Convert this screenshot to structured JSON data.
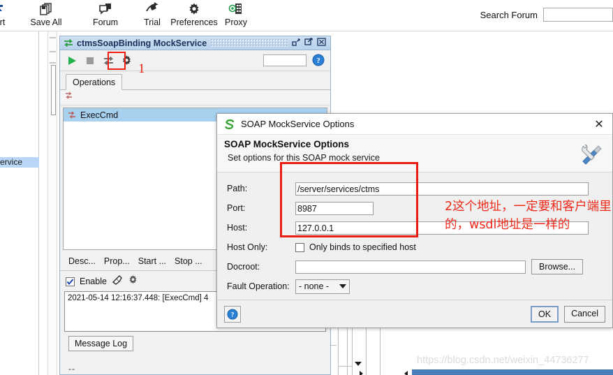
{
  "toolbar": {
    "items": [
      {
        "label": "ort",
        "icon": "import-icon"
      },
      {
        "label": "Save All",
        "icon": "save-all-icon"
      },
      {
        "label": "Forum",
        "icon": "forum-icon"
      },
      {
        "label": "Trial",
        "icon": "trial-icon"
      },
      {
        "label": "Preferences",
        "icon": "gear-icon"
      },
      {
        "label": "Proxy",
        "icon": "proxy-icon"
      }
    ],
    "search_forum_label": "Search Forum",
    "search_forum_value": "",
    "search_forum_placeholder": ""
  },
  "navigator": {
    "selected_item": "ckService"
  },
  "mock_window": {
    "title": "ctmsSoapBinding MockService",
    "title_icon": "mockservice-icon",
    "controls": {
      "minimize": "minimize-icon",
      "maximize": "maximize-icon",
      "close": "close-icon"
    },
    "toolbar": {
      "run": "run-icon",
      "stop": "stop-icon",
      "dispatch": "dispatch-icon",
      "options": "gear-icon",
      "field_value": "",
      "help": "help-icon"
    },
    "callout_1": "1",
    "tabs": [
      {
        "label": "Operations",
        "active": true
      }
    ],
    "operations": [
      {
        "label": "ExecCmd",
        "selected": true
      }
    ],
    "buttons": [
      "Desc...",
      "Prop...",
      "Start ...",
      "Stop ..."
    ],
    "enable_checkbox": {
      "label": "Enable",
      "checked": true
    },
    "log_line": "2021-05-14 12:16:37.448: [ExecCmd] 4",
    "message_log_tab": "Message Log",
    "status_dashes": "--"
  },
  "dialog": {
    "window_title": "SOAP MockService Options",
    "window_icon": "soapui-icon",
    "close_label": "✕",
    "banner_title": "SOAP MockService Options",
    "banner_subtitle": "Set options for this SOAP mock service",
    "banner_icon": "tools-icon",
    "fields": {
      "path": {
        "label": "Path:",
        "value": "/server/services/ctms"
      },
      "port": {
        "label": "Port:",
        "value": "8987"
      },
      "host": {
        "label": "Host:",
        "value": "127.0.0.1"
      },
      "host_only": {
        "label": "Host Only:",
        "checkbox_label": "Only binds to specified host",
        "checked": false
      },
      "docroot": {
        "label": "Docroot:",
        "value": "",
        "browse_label": "Browse..."
      },
      "fault_operation": {
        "label": "Fault Operation:",
        "value": "- none -"
      }
    },
    "footer": {
      "help_icon": "help-icon",
      "ok_label": "OK",
      "cancel_label": "Cancel"
    }
  },
  "annotations": {
    "chinese_note": "2这个地址，一定要和客户端里的，wsdl地址是一样的",
    "highlight_color": "#ea1c10"
  },
  "watermark": "https://blog.csdn.net/weixin_44736277"
}
